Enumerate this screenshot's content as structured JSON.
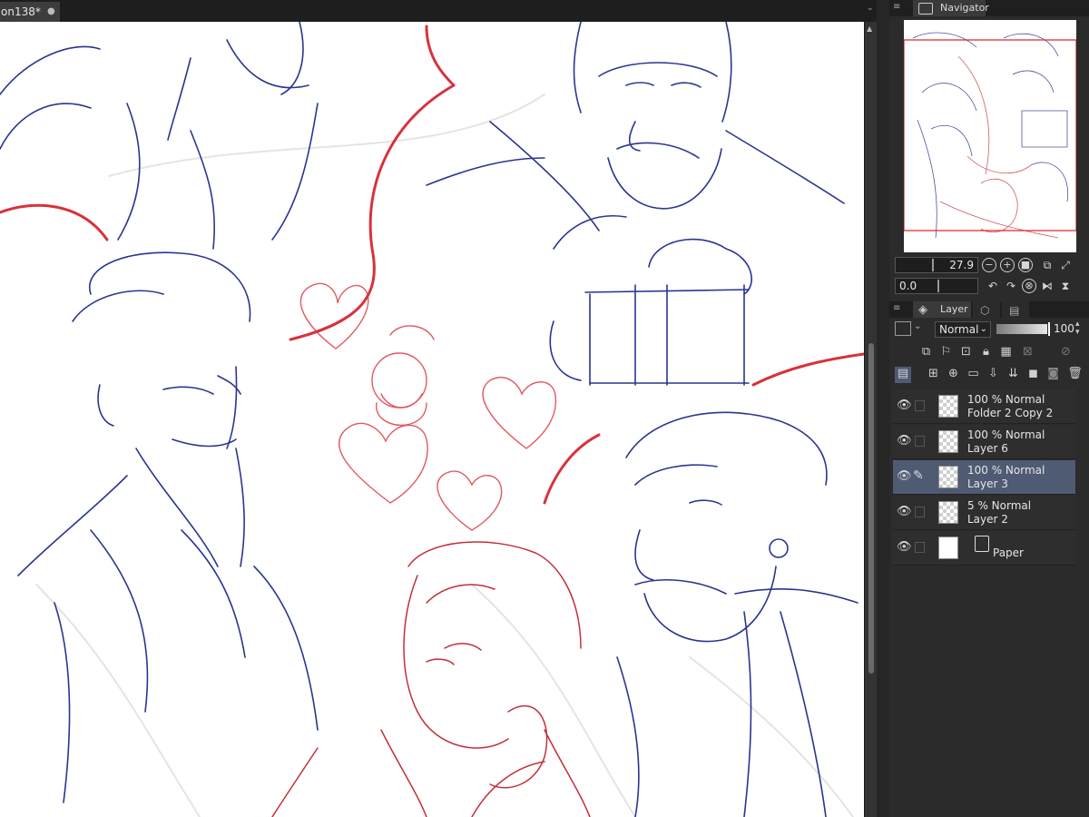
{
  "document": {
    "tab_title": "on138*",
    "close_glyph": "●"
  },
  "tab_menu_glyph": "⌄",
  "navigator": {
    "title": "Navigator",
    "zoom_value": "27.9",
    "rotation_value": "0.0"
  },
  "layer_panel": {
    "tabs": [
      "Layer",
      "",
      ""
    ],
    "blend_mode": "Normal",
    "opacity": "100",
    "layers": [
      {
        "opacity_mode": "100 % Normal",
        "name": "Folder 2 Copy 2",
        "selected": false,
        "type": "raster"
      },
      {
        "opacity_mode": "100 % Normal",
        "name": "Layer 6",
        "selected": false,
        "type": "raster"
      },
      {
        "opacity_mode": "100 % Normal",
        "name": "Layer 3",
        "selected": true,
        "type": "raster"
      },
      {
        "opacity_mode": "5 % Normal",
        "name": "Layer 2",
        "selected": false,
        "type": "raster"
      },
      {
        "opacity_mode": "",
        "name": "Paper",
        "selected": false,
        "type": "paper"
      }
    ]
  },
  "colors": {
    "sketch_blue": "#2a3590",
    "sketch_red": "#d8323c",
    "selection": "#4f5a73",
    "panel_bg": "#2b2b2b"
  },
  "icons": {
    "zoom_controls": [
      "zoom-out-icon",
      "zoom-in-icon",
      "fit-icon",
      "actual-size-icon",
      "fullscreen-icon"
    ],
    "rotate_controls": [
      "rotate-left-icon",
      "rotate-right-icon",
      "reset-rotation-icon",
      "flip-horizontal-icon",
      "flip-vertical-icon"
    ]
  }
}
